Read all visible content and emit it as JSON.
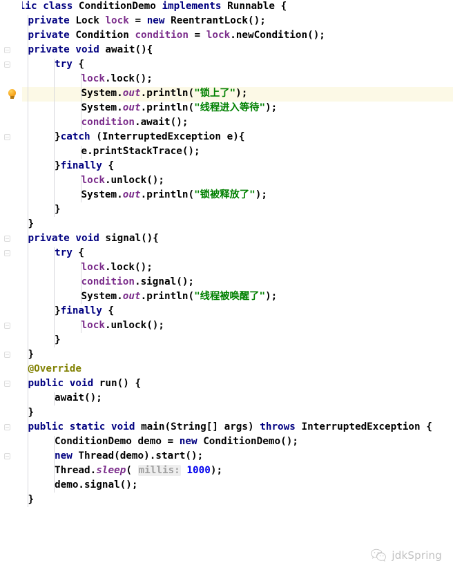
{
  "editor": {
    "language": "java",
    "file_class": "ConditionDemo",
    "theme": "light",
    "colors": {
      "background": "#ffffff",
      "keyword": "#000080",
      "field": "#7b2d8b",
      "string": "#008000",
      "number": "#0000ee",
      "annotation": "#808000",
      "caret_row_highlight": "#fcf9e6",
      "param_hint_background": "#eeeeee",
      "param_hint_text": "#a0a0a0",
      "indent_guide": "#d8d8dc",
      "bulb": "#f7a823"
    },
    "caret_line_index": 6,
    "gutter": {
      "bulb_icon": "lightbulb-icon",
      "bulb_line_index": 6,
      "fold_marker_icon": "fold-marker-icon",
      "fold_marker_lines": [
        3,
        4,
        9,
        16,
        17,
        22,
        24,
        26,
        29,
        31
      ]
    },
    "lines": [
      {
        "indent": 0,
        "tokens": [
          {
            "t": "public",
            "c": "kw"
          },
          {
            "t": " ",
            "c": "plain"
          },
          {
            "t": "class",
            "c": "kw"
          },
          {
            "t": " ConditionDemo ",
            "c": "plain"
          },
          {
            "t": "implements",
            "c": "kw"
          },
          {
            "t": " Runnable {",
            "c": "plain"
          }
        ]
      },
      {
        "indent": 1,
        "tokens": [
          {
            "t": "private",
            "c": "kw"
          },
          {
            "t": " Lock ",
            "c": "plain"
          },
          {
            "t": "lock",
            "c": "fld"
          },
          {
            "t": " = ",
            "c": "plain"
          },
          {
            "t": "new",
            "c": "kw"
          },
          {
            "t": " ReentrantLock();",
            "c": "plain"
          }
        ]
      },
      {
        "indent": 1,
        "tokens": [
          {
            "t": "private",
            "c": "kw"
          },
          {
            "t": " Condition ",
            "c": "plain"
          },
          {
            "t": "condition",
            "c": "fld"
          },
          {
            "t": " = ",
            "c": "plain"
          },
          {
            "t": "lock",
            "c": "fld"
          },
          {
            "t": ".newCondition();",
            "c": "plain"
          }
        ]
      },
      {
        "indent": 1,
        "tokens": [
          {
            "t": "private",
            "c": "kw"
          },
          {
            "t": " ",
            "c": "plain"
          },
          {
            "t": "void",
            "c": "kw"
          },
          {
            "t": " await(){",
            "c": "plain"
          }
        ]
      },
      {
        "indent": 2,
        "tokens": [
          {
            "t": "try",
            "c": "kw"
          },
          {
            "t": " {",
            "c": "plain"
          }
        ]
      },
      {
        "indent": 3,
        "tokens": [
          {
            "t": "lock",
            "c": "fld"
          },
          {
            "t": ".lock();",
            "c": "plain"
          }
        ]
      },
      {
        "indent": 3,
        "tokens": [
          {
            "t": "System.",
            "c": "plain"
          },
          {
            "t": "out",
            "c": "sfld"
          },
          {
            "t": ".println(",
            "c": "plain"
          },
          {
            "t": "\"锁上了\"",
            "c": "str"
          },
          {
            "t": ");",
            "c": "plain"
          }
        ]
      },
      {
        "indent": 3,
        "tokens": [
          {
            "t": "System.",
            "c": "plain"
          },
          {
            "t": "out",
            "c": "sfld"
          },
          {
            "t": ".println(",
            "c": "plain"
          },
          {
            "t": "\"线程进入等待\"",
            "c": "str"
          },
          {
            "t": ");",
            "c": "plain"
          }
        ]
      },
      {
        "indent": 3,
        "tokens": [
          {
            "t": "condition",
            "c": "fld"
          },
          {
            "t": ".await();",
            "c": "plain"
          }
        ]
      },
      {
        "indent": 2,
        "tokens": [
          {
            "t": "}",
            "c": "plain"
          },
          {
            "t": "catch",
            "c": "kw"
          },
          {
            "t": " (InterruptedException e){",
            "c": "plain"
          }
        ]
      },
      {
        "indent": 3,
        "tokens": [
          {
            "t": "e.printStackTrace();",
            "c": "plain"
          }
        ]
      },
      {
        "indent": 2,
        "tokens": [
          {
            "t": "}",
            "c": "plain"
          },
          {
            "t": "finally",
            "c": "kw"
          },
          {
            "t": " {",
            "c": "plain"
          }
        ]
      },
      {
        "indent": 3,
        "tokens": [
          {
            "t": "lock",
            "c": "fld"
          },
          {
            "t": ".unlock();",
            "c": "plain"
          }
        ]
      },
      {
        "indent": 3,
        "tokens": [
          {
            "t": "System.",
            "c": "plain"
          },
          {
            "t": "out",
            "c": "sfld"
          },
          {
            "t": ".println(",
            "c": "plain"
          },
          {
            "t": "\"锁被释放了\"",
            "c": "str"
          },
          {
            "t": ");",
            "c": "plain"
          }
        ]
      },
      {
        "indent": 2,
        "tokens": [
          {
            "t": "}",
            "c": "plain"
          }
        ]
      },
      {
        "indent": 1,
        "tokens": [
          {
            "t": "}",
            "c": "plain"
          }
        ]
      },
      {
        "indent": 1,
        "tokens": [
          {
            "t": "private",
            "c": "kw"
          },
          {
            "t": " ",
            "c": "plain"
          },
          {
            "t": "void",
            "c": "kw"
          },
          {
            "t": " signal(){",
            "c": "plain"
          }
        ]
      },
      {
        "indent": 2,
        "tokens": [
          {
            "t": "try",
            "c": "kw"
          },
          {
            "t": " {",
            "c": "plain"
          }
        ]
      },
      {
        "indent": 3,
        "tokens": [
          {
            "t": "lock",
            "c": "fld"
          },
          {
            "t": ".lock();",
            "c": "plain"
          }
        ]
      },
      {
        "indent": 3,
        "tokens": [
          {
            "t": "condition",
            "c": "fld"
          },
          {
            "t": ".signal();",
            "c": "plain"
          }
        ]
      },
      {
        "indent": 3,
        "tokens": [
          {
            "t": "System.",
            "c": "plain"
          },
          {
            "t": "out",
            "c": "sfld"
          },
          {
            "t": ".println(",
            "c": "plain"
          },
          {
            "t": "\"线程被唤醒了\"",
            "c": "str"
          },
          {
            "t": ");",
            "c": "plain"
          }
        ]
      },
      {
        "indent": 2,
        "tokens": [
          {
            "t": "}",
            "c": "plain"
          },
          {
            "t": "finally",
            "c": "kw"
          },
          {
            "t": " {",
            "c": "plain"
          }
        ]
      },
      {
        "indent": 3,
        "tokens": [
          {
            "t": "lock",
            "c": "fld"
          },
          {
            "t": ".unlock();",
            "c": "plain"
          }
        ]
      },
      {
        "indent": 2,
        "tokens": [
          {
            "t": "}",
            "c": "plain"
          }
        ]
      },
      {
        "indent": 1,
        "tokens": [
          {
            "t": "}",
            "c": "plain"
          }
        ]
      },
      {
        "indent": 1,
        "tokens": [
          {
            "t": "@Override",
            "c": "anno"
          }
        ]
      },
      {
        "indent": 1,
        "tokens": [
          {
            "t": "public",
            "c": "kw"
          },
          {
            "t": " ",
            "c": "plain"
          },
          {
            "t": "void",
            "c": "kw"
          },
          {
            "t": " run() {",
            "c": "plain"
          }
        ]
      },
      {
        "indent": 2,
        "tokens": [
          {
            "t": "await();",
            "c": "plain"
          }
        ]
      },
      {
        "indent": 1,
        "tokens": [
          {
            "t": "}",
            "c": "plain"
          }
        ]
      },
      {
        "indent": 1,
        "tokens": [
          {
            "t": "public",
            "c": "kw"
          },
          {
            "t": " ",
            "c": "plain"
          },
          {
            "t": "static",
            "c": "kw"
          },
          {
            "t": " ",
            "c": "plain"
          },
          {
            "t": "void",
            "c": "kw"
          },
          {
            "t": " main(String[] args) ",
            "c": "plain"
          },
          {
            "t": "throws",
            "c": "kw"
          },
          {
            "t": " InterruptedException {",
            "c": "plain"
          }
        ]
      },
      {
        "indent": 2,
        "tokens": [
          {
            "t": "ConditionDemo demo = ",
            "c": "plain"
          },
          {
            "t": "new",
            "c": "kw"
          },
          {
            "t": " ConditionDemo();",
            "c": "plain"
          }
        ]
      },
      {
        "indent": 2,
        "tokens": [
          {
            "t": "new",
            "c": "kw"
          },
          {
            "t": " Thread(demo).start();",
            "c": "plain"
          }
        ]
      },
      {
        "indent": 2,
        "tokens": [
          {
            "t": "Thread.",
            "c": "plain"
          },
          {
            "t": "sleep",
            "c": "sfld"
          },
          {
            "t": "( ",
            "c": "plain"
          },
          {
            "t": "millis:",
            "c": "hint"
          },
          {
            "t": " ",
            "c": "plain"
          },
          {
            "t": "1000",
            "c": "num"
          },
          {
            "t": ");",
            "c": "plain"
          }
        ]
      },
      {
        "indent": 2,
        "tokens": [
          {
            "t": "demo.signal();",
            "c": "plain"
          }
        ]
      },
      {
        "indent": 1,
        "tokens": [
          {
            "t": "}",
            "c": "plain"
          }
        ]
      },
      {
        "indent": 0,
        "tokens": [
          {
            "t": "}",
            "c": "plain"
          }
        ]
      }
    ]
  },
  "watermark": {
    "label": "jdkSpring",
    "logo_icon": "wechat-logo-icon"
  }
}
